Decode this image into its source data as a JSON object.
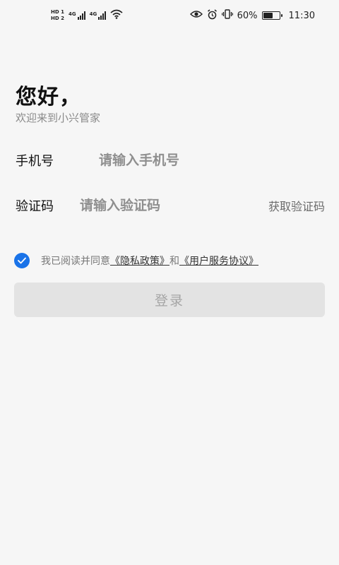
{
  "status_bar": {
    "hd1": "HD 1",
    "hd2": "HD 2",
    "net1": "4G",
    "net2": "4G",
    "battery_percent": "60%",
    "battery_level": 0.6,
    "time": "11:30",
    "icons": [
      "eye-icon",
      "alarm-icon",
      "vibrate-icon",
      "wifi-icon"
    ]
  },
  "header": {
    "greeting": "您好，",
    "subtitle": "欢迎来到小兴管家"
  },
  "form": {
    "phone_label": "手机号",
    "phone_placeholder": "请输入手机号",
    "phone_value": "",
    "code_label": "验证码",
    "code_placeholder": "请输入验证码",
    "code_value": "",
    "get_code": "获取验证码"
  },
  "agreement": {
    "checked": true,
    "prefix": "我已阅读并同意",
    "privacy": "《隐私政策》",
    "and": "和",
    "terms": "《用户服务协议》"
  },
  "login": {
    "label": "登录"
  },
  "colors": {
    "accent": "#1a73e8",
    "background": "#f6f6f6",
    "button_disabled": "#e3e3e3"
  }
}
